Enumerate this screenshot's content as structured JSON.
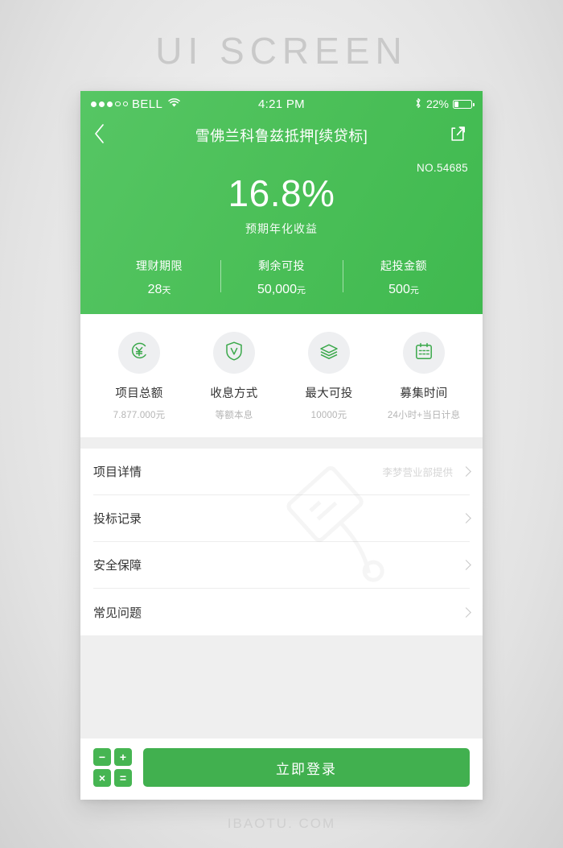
{
  "page": {
    "headline": "UI  SCREEN",
    "footer": "IBAOTU. COM"
  },
  "statusbar": {
    "carrier": "BELL",
    "time": "4:21 PM",
    "battery_percent": "22%",
    "bluetooth_icon": "bluetooth-icon",
    "wifi_icon": "wifi-icon",
    "battery_icon": "battery-icon"
  },
  "navbar": {
    "back_icon": "chevron-left-icon",
    "title": "雪佛兰科鲁兹抵押[续贷标]",
    "share_icon": "share-icon"
  },
  "hero": {
    "serial": "NO.54685",
    "rate": "16.8%",
    "rate_caption": "预期年化收益",
    "stats": [
      {
        "label": "理财期限",
        "value": "28",
        "unit": "天"
      },
      {
        "label": "剩余可投",
        "value": "50,000",
        "unit": "元"
      },
      {
        "label": "起投金额",
        "value": "500",
        "unit": "元"
      }
    ]
  },
  "features": [
    {
      "icon": "yen-circle-icon",
      "title": "项目总额",
      "sub": "7.877.000元"
    },
    {
      "icon": "shield-check-icon",
      "title": "收息方式",
      "sub": "等额本息"
    },
    {
      "icon": "layers-icon",
      "title": "最大可投",
      "sub": "10000元"
    },
    {
      "icon": "calendar-icon",
      "title": "募集时间",
      "sub": "24小时+当日计息"
    }
  ],
  "list": [
    {
      "label": "项目详情",
      "extra": "李梦营业部提供"
    },
    {
      "label": "投标记录",
      "extra": ""
    },
    {
      "label": "安全保障",
      "extra": ""
    },
    {
      "label": "常见问题",
      "extra": ""
    }
  ],
  "bottombar": {
    "calculator_icon": "calculator-icon",
    "calc_keys": [
      "−",
      "+",
      "×",
      "="
    ],
    "login_label": "立即登录"
  },
  "colors": {
    "brand_green": "#4cc059",
    "button_green": "#41b04f",
    "page_bg": "#e9e9e9"
  }
}
